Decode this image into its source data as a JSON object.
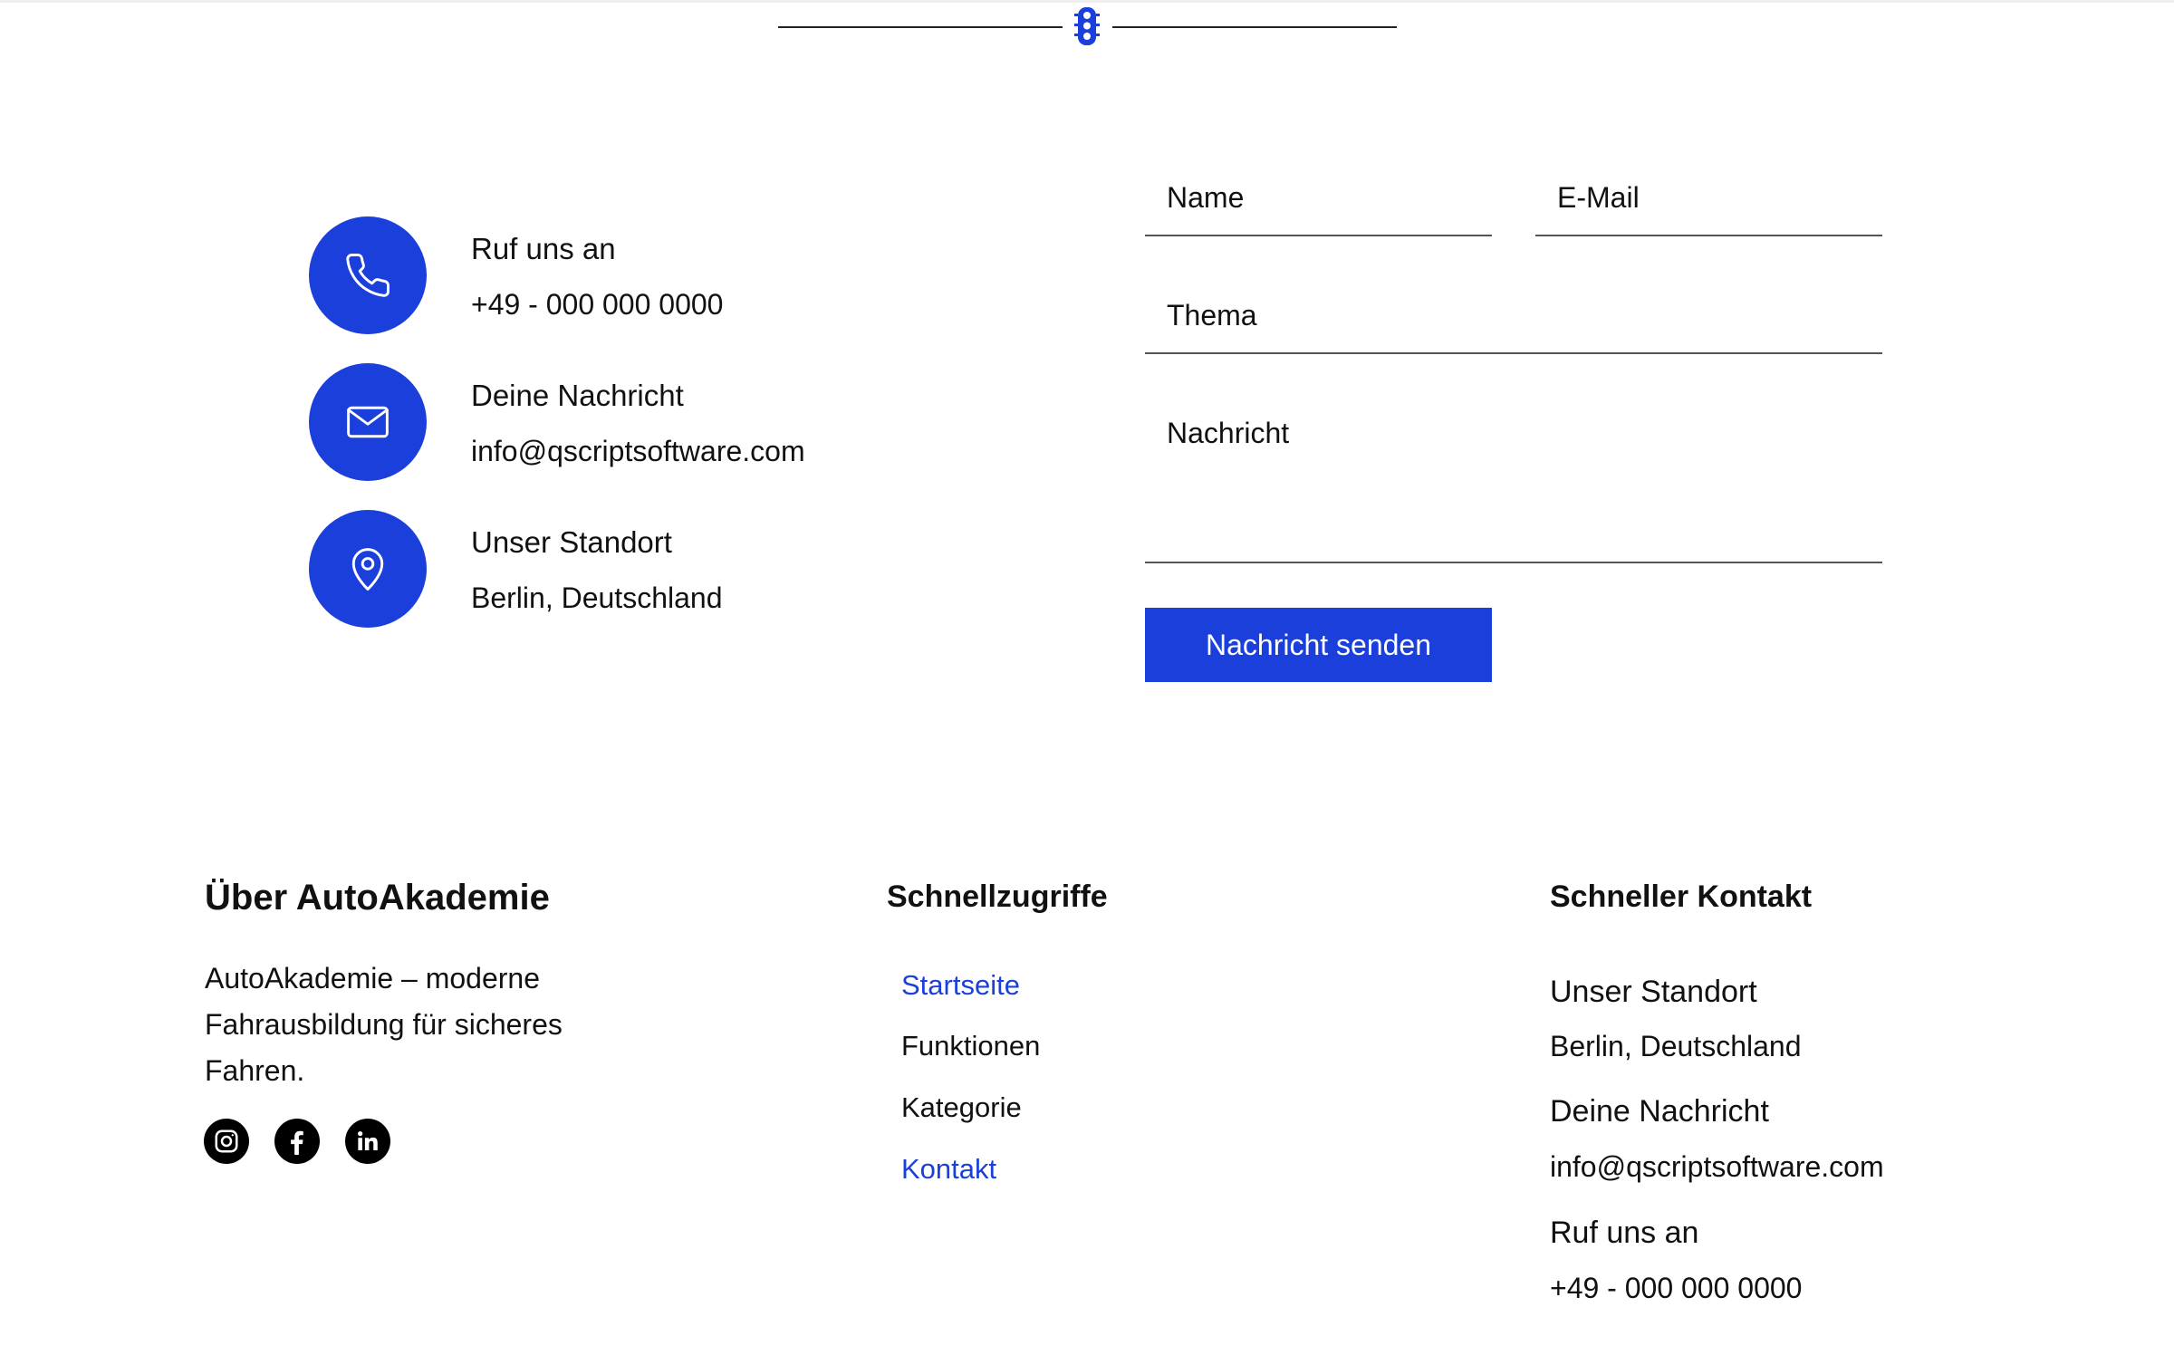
{
  "colors": {
    "accent": "#1a3fdb",
    "text": "#111111",
    "link_active": "#1a3fdb"
  },
  "divider": {
    "icon": "traffic-light-icon"
  },
  "contact_info": [
    {
      "icon": "phone-icon",
      "label": "Ruf uns an",
      "value": "+49 - 000 000 0000"
    },
    {
      "icon": "mail-icon",
      "label": "Deine Nachricht",
      "value": "info@qscriptsoftware.com"
    },
    {
      "icon": "location-pin-icon",
      "label": "Unser Standort",
      "value": "Berlin, Deutschland"
    }
  ],
  "form": {
    "name_label": "Name",
    "email_label": "E-Mail",
    "subject_label": "Thema",
    "message_label": "Nachricht",
    "submit_label": "Nachricht senden"
  },
  "footer": {
    "about": {
      "heading": "Über AutoAkademie",
      "text": "AutoAkademie – moderne Fahrausbildung für sicheres Fahren.",
      "social": [
        "instagram-icon",
        "facebook-icon",
        "linkedin-icon"
      ]
    },
    "quick_links": {
      "heading": "Schnellzugriffe",
      "items": [
        {
          "label": "Startseite",
          "highlighted": true
        },
        {
          "label": "Funktionen",
          "highlighted": false
        },
        {
          "label": "Kategorie",
          "highlighted": false
        },
        {
          "label": "Kontakt",
          "highlighted": true
        }
      ]
    },
    "quick_contact": {
      "heading": "Schneller Kontakt",
      "location_label": "Unser Standort",
      "location_value": "Berlin, Deutschland",
      "message_label": "Deine Nachricht",
      "message_value": "info@qscriptsoftware.com",
      "phone_label": "Ruf uns an",
      "phone_value": "+49 - 000 000 0000"
    }
  }
}
